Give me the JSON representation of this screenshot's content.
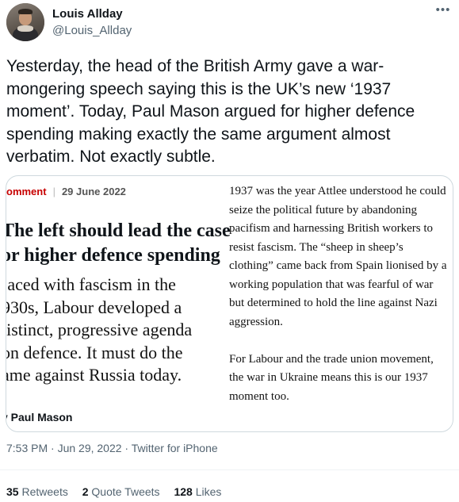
{
  "author": {
    "name": "Louis Allday",
    "handle": "@Louis_Allday"
  },
  "more_icon": "more-horizontal-icon",
  "tweet_text": "Yesterday, the head of the British Army gave a war-mongering speech saying this is the UK’s new ‘1937 moment’. Today, Paul Mason argued for higher defence spending making exactly the same argument almost verbatim. Not exactly subtle.",
  "card": {
    "section": "omment",
    "date": "29 June 2022",
    "headline_line1": "The left should lead the case",
    "headline_line2": "or higher defence spending",
    "standfirst_lines": [
      "‘aced with fascism in the",
      "930s, Labour developed a",
      "listinct, progressive agenda",
      "on defence. It must do the",
      "ame against Russia today."
    ],
    "byline": "y Paul Mason",
    "paragraph1": "1937 was the year Attlee understood he could seize the political future by abandoning pacifism and harnessing British workers to resist fascism. The “sheep in sheep’s clothing” came back from Spain lionised by a working population that was fearful of war but determined to hold the line against Nazi aggression.",
    "paragraph2": "For Labour and the trade union movement, the war in Ukraine means this is our 1937 moment too."
  },
  "timestamp": "7:53 PM · Jun 29, 2022 · Twitter for iPhone",
  "stats": {
    "retweets_count": "35",
    "retweets_label": "Retweets",
    "quotes_count": "2",
    "quotes_label": "Quote Tweets",
    "likes_count": "128",
    "likes_label": "Likes"
  },
  "colors": {
    "text": "#0f1419",
    "secondary": "#536471",
    "guardian_red": "#c70000",
    "border": "#cfd9de"
  }
}
